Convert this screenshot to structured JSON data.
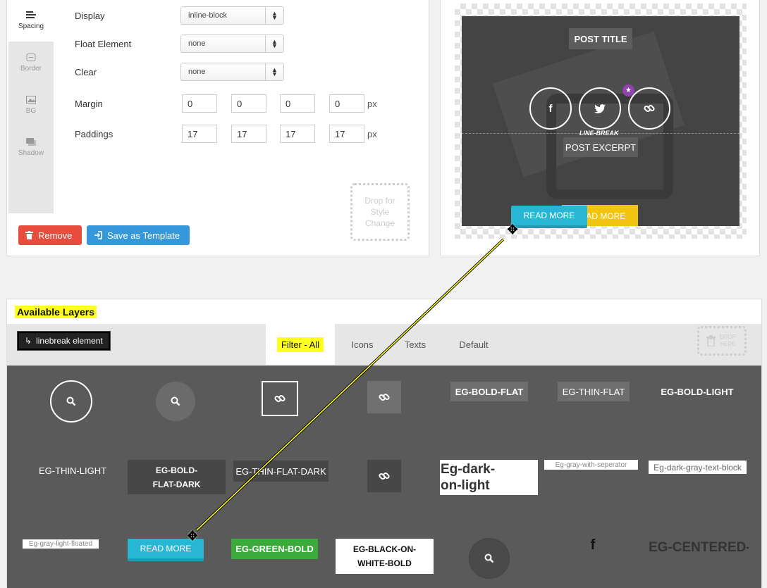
{
  "side_tabs": [
    {
      "label": "Spacing",
      "icon": "align-left-icon"
    },
    {
      "label": "Border",
      "icon": "border-icon"
    },
    {
      "label": "BG",
      "icon": "image-icon"
    },
    {
      "label": "Shadow",
      "icon": "shadow-icon"
    }
  ],
  "form": {
    "display": {
      "label": "Display",
      "value": "inline-block"
    },
    "float": {
      "label": "Float Element",
      "value": "none"
    },
    "clear": {
      "label": "Clear",
      "value": "none"
    },
    "margin": {
      "label": "Margin",
      "values": [
        "0",
        "0",
        "0",
        "0"
      ],
      "unit": "px"
    },
    "paddings": {
      "label": "Paddings",
      "values": [
        "17",
        "17",
        "17",
        "17"
      ],
      "unit": "px"
    }
  },
  "drop_style": "Drop for Style Change",
  "buttons": {
    "remove": "Remove",
    "save_template": "Save as Template"
  },
  "preview": {
    "post_title": "POST TITLE",
    "line_break": "LINE-BREAK",
    "post_excerpt": "POST EXCERPT",
    "read_more": "READ MORE",
    "read_more_drag": "READ MORE",
    "social": [
      "f",
      "t",
      "link"
    ]
  },
  "layers": {
    "title": "Available Layers",
    "linebreak_element": "linebreak element",
    "tabs": [
      "Filter - All",
      "Icons",
      "Texts",
      "Default"
    ],
    "drop_here": "DROP HERE",
    "items": {
      "eg_bold_flat": "EG-BOLD-FLAT",
      "eg_thin_flat": "EG-THIN-FLAT",
      "eg_bold_light": "EG-BOLD-LIGHT",
      "eg_thin_light": "EG-THIN-LIGHT",
      "eg_bold_flat_dark": "EG-BOLD-FLAT-DARK",
      "eg_thin_flat_dark": "EG-THIN-FLAT-DARK",
      "eg_dark_on_light": "Eg-dark-on-light",
      "eg_gray_with_seperator": "Eg-gray-with-seperator",
      "eg_dark_gray_text_block": "Eg-dark-gray-text-block",
      "eg_gray_light_floated": "Eg-gray-light-floated",
      "read_more": "READ MORE",
      "eg_green_bold": "EG-GREEN-BOLD",
      "eg_black_on_white_bold": "EG-BLACK-ON-WHITE-BOLD",
      "eg_centered_dark_extrabold": "EG-CENTERED-DARK-EXTRABOLD",
      "facebook": "f"
    }
  },
  "colors": {
    "remove": "#e74c3c",
    "save": "#3498db",
    "highlight": "#ffff1f",
    "read_more": "#27b6d4",
    "read_more_yellow": "#f1c40f",
    "green": "#3aab3a",
    "star": "#8e44ad"
  }
}
